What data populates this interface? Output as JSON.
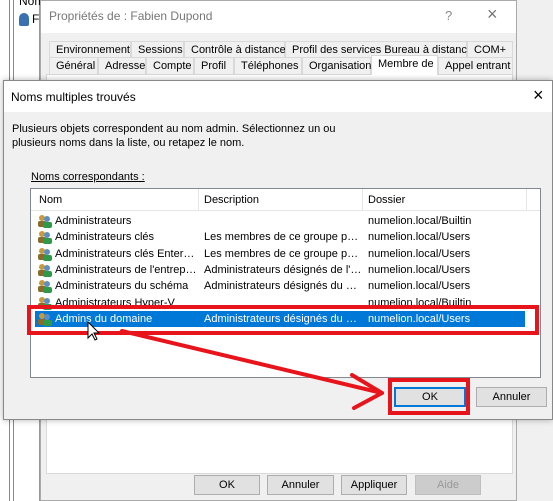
{
  "background": {
    "column_header": "Nom",
    "user_initial": "F"
  },
  "properties_dialog": {
    "title": "Propriétés de : Fabien Dupond",
    "help": "?",
    "close": "×",
    "tabs_row1": [
      "Environnement",
      "Sessions",
      "Contrôle à distance",
      "Profil des services Bureau à distance",
      "COM+"
    ],
    "tabs_row2": [
      "Général",
      "Adresse",
      "Compte",
      "Profil",
      "Téléphones",
      "Organisation",
      "Membre de",
      "Appel entrant"
    ],
    "active_tab": "Membre de",
    "buttons": {
      "ok": "OK",
      "cancel": "Annuler",
      "apply": "Appliquer",
      "help": "Aide"
    }
  },
  "multi_dialog": {
    "title": "Noms multiples trouvés",
    "close": "×",
    "instructions": "Plusieurs objets correspondent au nom admin. Sélectionnez un ou plusieurs noms dans la liste, ou retapez le nom.",
    "list_label": "Noms correspondants :",
    "columns": [
      "Nom",
      "Description",
      "Dossier"
    ],
    "rows": [
      {
        "name": "Administrateurs",
        "description": "",
        "folder": "numelion.local/Builtin"
      },
      {
        "name": "Administrateurs clés",
        "description": "Les membres de ce groupe peu...",
        "folder": "numelion.local/Users"
      },
      {
        "name": "Administrateurs clés Enterprise",
        "description": "Les membres de ce groupe peu...",
        "folder": "numelion.local/Users"
      },
      {
        "name": "Administrateurs de l'entreprise",
        "description": "Administrateurs désignés de l'e...",
        "folder": "numelion.local/Users"
      },
      {
        "name": "Administrateurs du schéma",
        "description": "Administrateurs désignés du sc...",
        "folder": "numelion.local/Users"
      },
      {
        "name": "Administrateurs Hyper-V",
        "description": "",
        "folder": "numelion.local/Builtin"
      },
      {
        "name": "Admins du domaine",
        "description": "Administrateurs désignés du do...",
        "folder": "numelion.local/Users",
        "selected": true
      }
    ],
    "buttons": {
      "ok": "OK",
      "cancel": "Annuler"
    }
  },
  "colors": {
    "selection": "#0078d7",
    "annotation": "#e8141c"
  }
}
